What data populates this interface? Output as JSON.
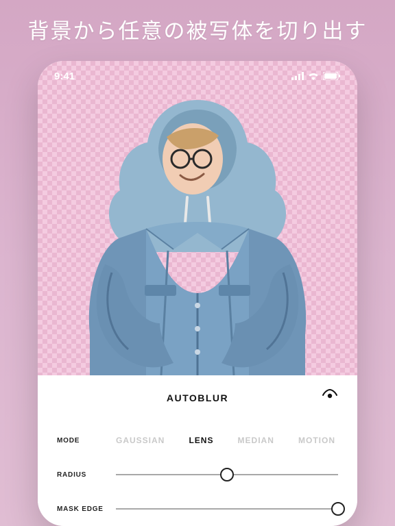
{
  "headline": "背景から任意の被写体を切り出す",
  "status": {
    "time": "9:41"
  },
  "controls": {
    "title": "AUTOBLUR",
    "mode": {
      "label": "MODE",
      "options": [
        "GAUSSIAN",
        "LENS",
        "MEDIAN",
        "MOTION"
      ],
      "active": "LENS"
    },
    "radius": {
      "label": "RADIUS",
      "value": 50
    },
    "mask_edge": {
      "label": "MASK EDGE",
      "value": 100
    }
  }
}
